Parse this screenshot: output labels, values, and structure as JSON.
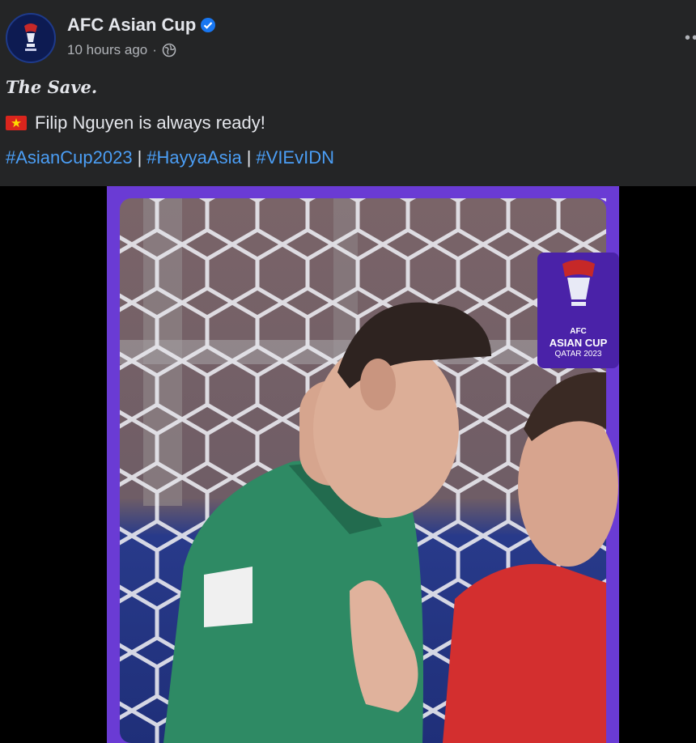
{
  "post": {
    "author": "AFC Asian Cup",
    "timestamp": "10 hours ago",
    "title": "The Save.",
    "line": "Filip Nguyen is always ready!",
    "hashtags": [
      "#AsianCup2023",
      "#HayyaAsia",
      "#VIEvIDN"
    ],
    "separator": "|"
  },
  "media": {
    "badge_line1": "AFC",
    "badge_line2": "ASIAN CUP",
    "badge_line3": "QATAR 2023"
  },
  "colors": {
    "card_bg": "#242526",
    "hashtag": "#4b9ef5",
    "verified": "#1877f2",
    "frame": "#6a3bd4"
  },
  "icons": {
    "verified": "verified-badge-icon",
    "audience": "globe-icon",
    "menu": "more-options-icon"
  }
}
